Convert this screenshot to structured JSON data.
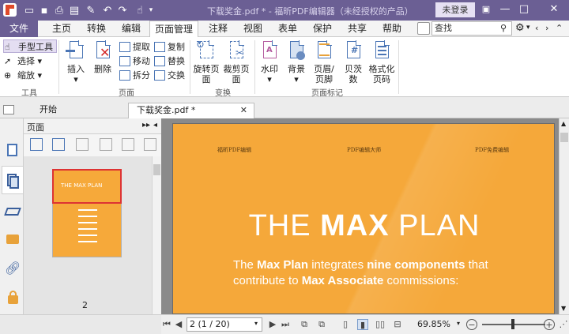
{
  "app": {
    "title": "下载奖金.pdf * - 福昕PDF编辑器（未经授权的产品）",
    "login": "未登录"
  },
  "menu": {
    "file": "文件",
    "tabs": [
      "主页",
      "转换",
      "编辑",
      "页面管理",
      "注释",
      "视图",
      "表单",
      "保护",
      "共享",
      "帮助"
    ],
    "active_tab": "页面管理",
    "search_placeholder": "查找"
  },
  "ribbon": {
    "tools_group": {
      "label": "工具",
      "hand": "手型工具",
      "select": "选择",
      "zoom": "缩放"
    },
    "pages_group": {
      "label": "页面",
      "insert": "插入",
      "delete": "删除",
      "extract": "提取",
      "move": "移动",
      "split": "拆分",
      "copy": "复制",
      "replace": "替换",
      "swap": "交换"
    },
    "transform_group": {
      "label": "变换",
      "rotate": "旋转页面",
      "crop": "裁剪页面"
    },
    "marks_group": {
      "label": "页面标记",
      "watermark": "水印",
      "background": "背景",
      "header_footer": "页眉/页脚",
      "bates": "贝茨数",
      "format_page": "格式化页码"
    }
  },
  "doc_tabs": {
    "start": "开始",
    "current": "下载奖金.pdf *"
  },
  "panel": {
    "title": "页面",
    "thumb_label": "2"
  },
  "page_content": {
    "header_left": "福昕PDF编辑",
    "header_center": "PDF编辑大师",
    "header_right": "PDF免费编辑",
    "title_light1": "THE ",
    "title_bold": "MAX",
    "title_light2": " PLAN",
    "line1_a": "The ",
    "line1_b": "Max Plan",
    "line1_c": " integrates ",
    "line1_d": "nine components",
    "line1_e": " that",
    "line2_a": "contribute to ",
    "line2_b": "Max Associate",
    "line2_c": " commissions:"
  },
  "status": {
    "page_input": "2 (1 / 20)",
    "zoom": "69.85%"
  },
  "colors": {
    "titlebar": "#6b5f94",
    "page_orange": "#f5a83a",
    "accent_blue": "#4a75b5"
  }
}
